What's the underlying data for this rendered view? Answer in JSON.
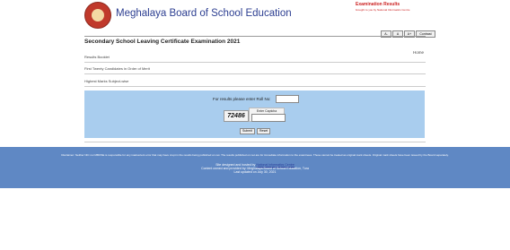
{
  "header": {
    "site_title": "Meghalaya Board of School Education",
    "exam_results": "Examination Results",
    "brought_by": "brought to you by National Informatics Centre"
  },
  "font_controls": [
    "A-",
    "A",
    "A+",
    "Contrast"
  ],
  "page": {
    "heading": "Secondary School Leaving Certificate Examination 2021",
    "home_link": "Home"
  },
  "menu": [
    {
      "label": "Results Booklet"
    },
    {
      "label": "First Twenty Candidates in Order of Merit"
    },
    {
      "label": "Highest Marks Subject-wise"
    }
  ],
  "form": {
    "roll_label": "For results please enter Roll No:",
    "roll_value": "",
    "captcha_text": "72486",
    "captcha_label": "Enter Captcha",
    "captcha_value": "",
    "submit_label": "Submit",
    "reset_label": "Reset"
  },
  "footer": {
    "disclaimer": "Disclaimer: Neither NIC nor MBOSE is responsible for any inadvertent error that may have crept in the results being published on net. The results published on net are for immediate information to the examinees. These cannot be treated as original mark sheets. Original mark sheets have been issued by the Board separately.",
    "designed_prefix": "Site designed and hosted by",
    "nic_link": "National Informatics Centre",
    "content_line": "Content owned and provided by: Meghalaya Board of School Education, Tura",
    "updated_line": "Last updated on July 30, 2021"
  },
  "colors": {
    "title_blue": "#2c3e91",
    "accent_red": "#cc2222",
    "form_panel": "#a9cdee",
    "footer_bg": "#5f88c4"
  },
  "icons": {
    "logo": "mbose-emblem-icon"
  }
}
